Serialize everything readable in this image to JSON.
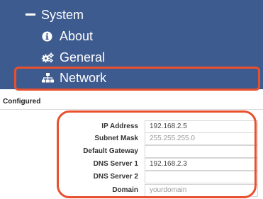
{
  "sidebar": {
    "items": [
      {
        "label": "System",
        "icon": "minus-icon"
      },
      {
        "label": "About",
        "icon": "info-circle-icon"
      },
      {
        "label": "General",
        "icon": "gears-icon"
      },
      {
        "label": "Network",
        "icon": "sitemap-icon",
        "selected": true
      }
    ]
  },
  "panel": {
    "heading": "Configured"
  },
  "form": {
    "ip_address": {
      "label": "IP Address",
      "value": "192.168.2.5",
      "placeholder": ""
    },
    "subnet_mask": {
      "label": "Subnet Mask",
      "value": "",
      "placeholder": "255.255.255.0"
    },
    "default_gateway": {
      "label": "Default Gateway",
      "value": "",
      "placeholder": ""
    },
    "dns_server_1": {
      "label": "DNS Server 1",
      "value": "192.168.2.3",
      "placeholder": ""
    },
    "dns_server_2": {
      "label": "DNS Server 2",
      "value": "",
      "placeholder": ""
    },
    "domain": {
      "label": "Domain",
      "value": "",
      "placeholder": "yourdomain"
    }
  },
  "colors": {
    "sidebar_bg": "#3e5b8f",
    "highlight": "#e8502e",
    "text_white": "#ffffff"
  }
}
